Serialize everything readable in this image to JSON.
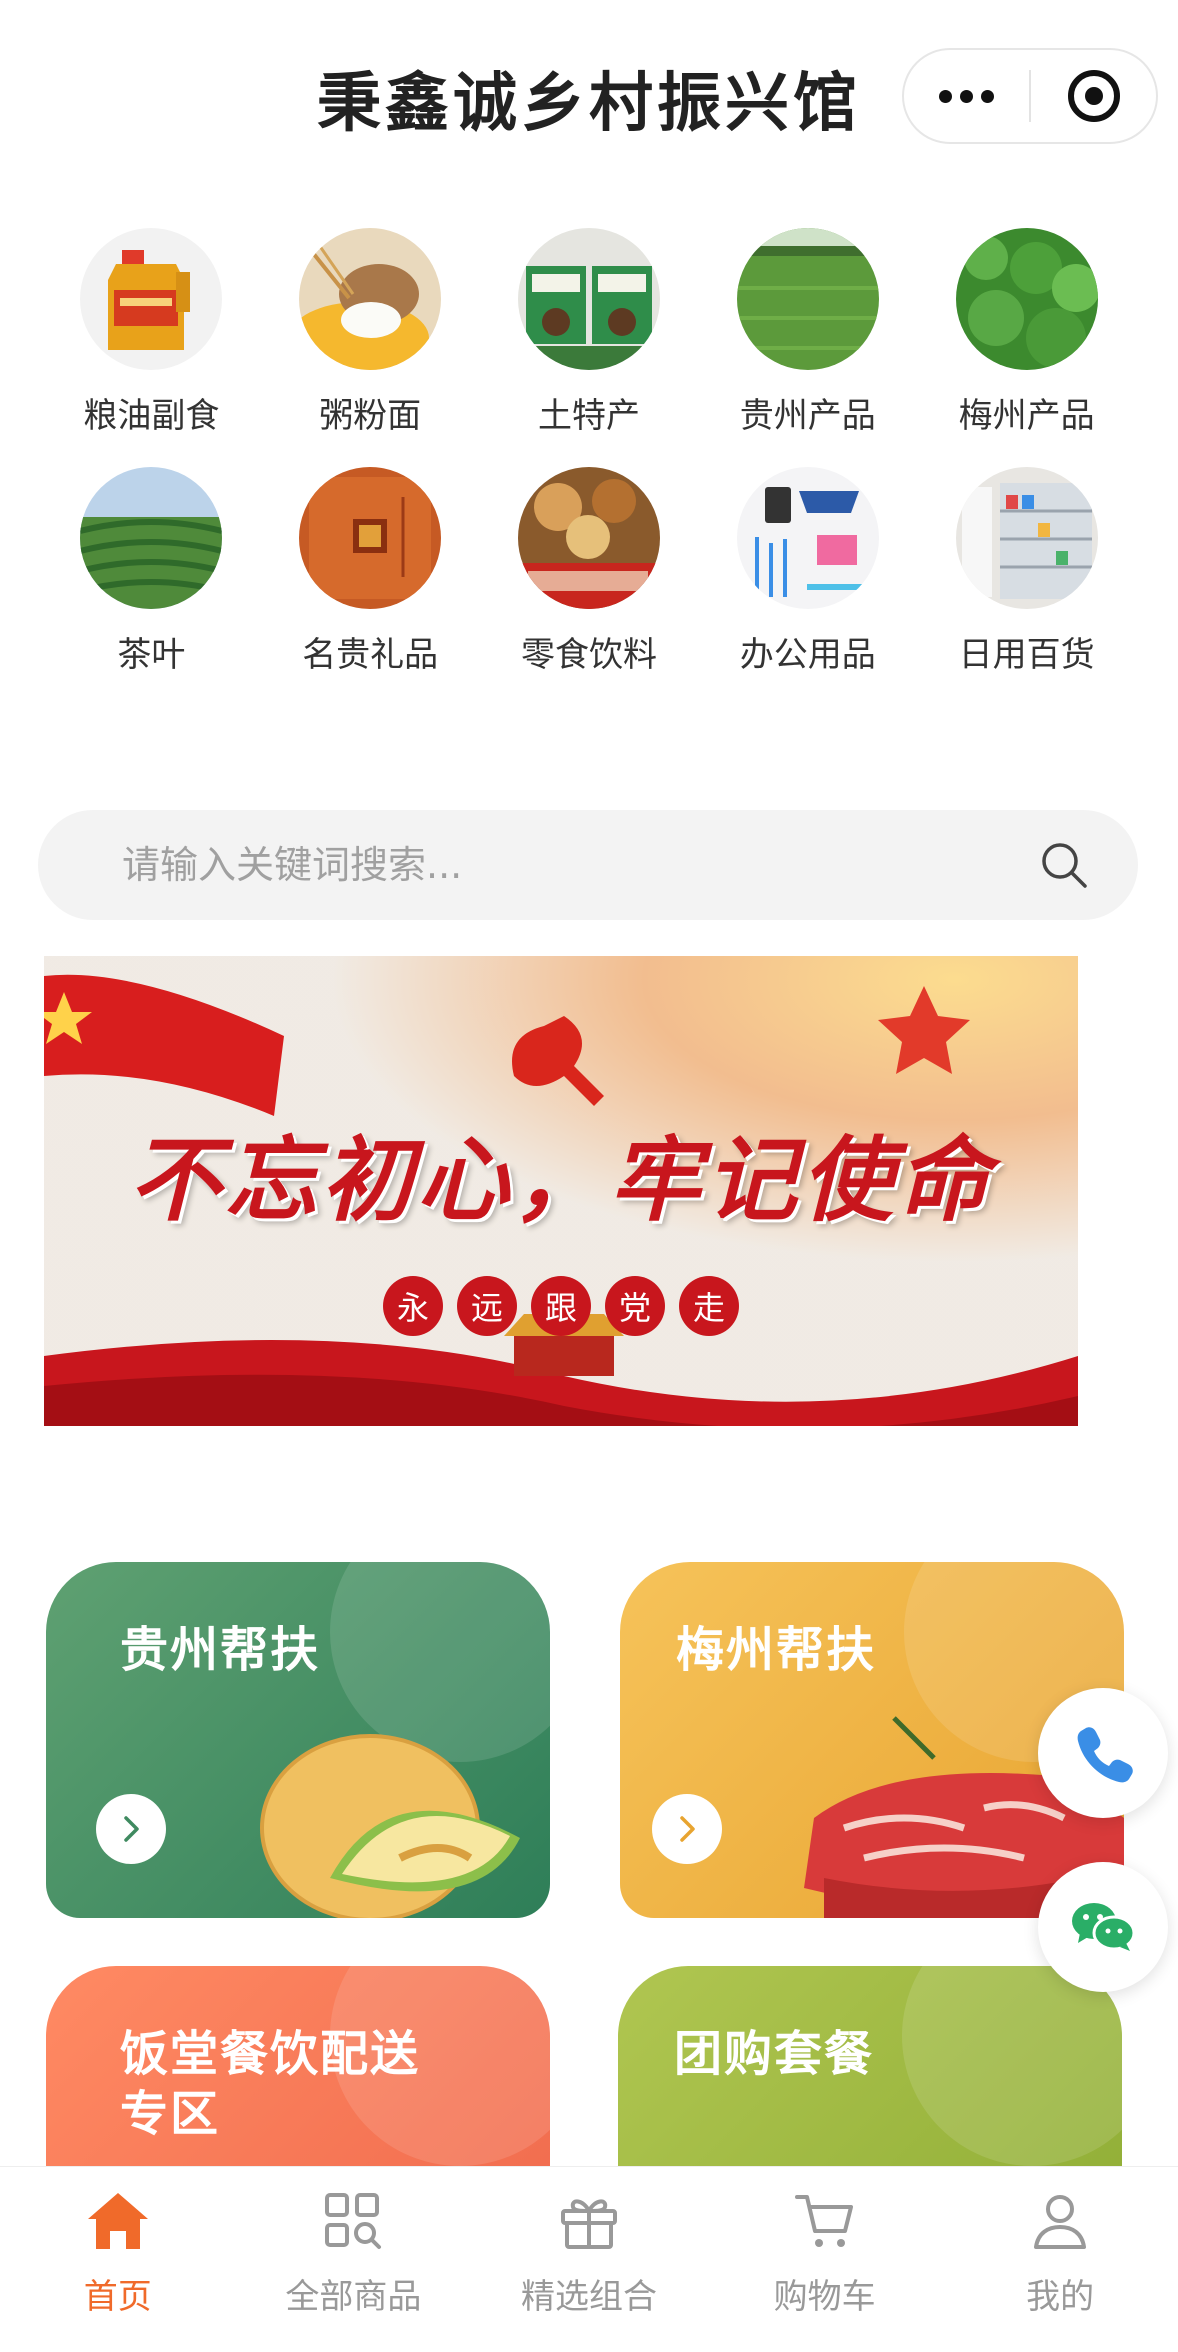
{
  "header": {
    "title": "秉鑫诚乡村振兴馆",
    "more_icon": "more-dots-icon",
    "close_icon": "target-icon"
  },
  "categories": [
    {
      "label": "粮油副食",
      "icon": "cooking-oil"
    },
    {
      "label": "粥粉面",
      "icon": "flour-grain"
    },
    {
      "label": "土特产",
      "icon": "local-specialty"
    },
    {
      "label": "贵州产品",
      "icon": "rice-field"
    },
    {
      "label": "梅州产品",
      "icon": "green-plants"
    },
    {
      "label": "茶叶",
      "icon": "tea-garden"
    },
    {
      "label": "名贵礼品",
      "icon": "gift-box"
    },
    {
      "label": "零食饮料",
      "icon": "snacks"
    },
    {
      "label": "办公用品",
      "icon": "stationery"
    },
    {
      "label": "日用百货",
      "icon": "store-shelf"
    }
  ],
  "search": {
    "placeholder": "请输入关键词搜索..."
  },
  "banner": {
    "slogan": "不忘初心，牢记使命",
    "sub_chars": [
      "永",
      "远",
      "跟",
      "党",
      "走"
    ]
  },
  "feature_cards": [
    {
      "title": "贵州帮扶",
      "color": "#3f8a60"
    },
    {
      "title": "梅州帮扶",
      "color": "#efb040"
    },
    {
      "title_line1": "饭堂餐饮配送",
      "title_line2": "专区",
      "color": "#f47755"
    },
    {
      "title": "团购套餐",
      "color": "#9fb945"
    }
  ],
  "floating": {
    "phone_icon": "phone-icon",
    "wechat_icon": "wechat-icon",
    "phone_color": "#3a8ee6",
    "wechat_color": "#2aae67"
  },
  "tabbar": {
    "active_color": "#f06a2a",
    "tabs": [
      {
        "label": "首页",
        "icon": "home-icon",
        "active": true
      },
      {
        "label": "全部商品",
        "icon": "grid-search-icon",
        "active": false
      },
      {
        "label": "精选组合",
        "icon": "gift-icon",
        "active": false
      },
      {
        "label": "购物车",
        "icon": "cart-icon",
        "active": false
      },
      {
        "label": "我的",
        "icon": "user-icon",
        "active": false
      }
    ]
  }
}
